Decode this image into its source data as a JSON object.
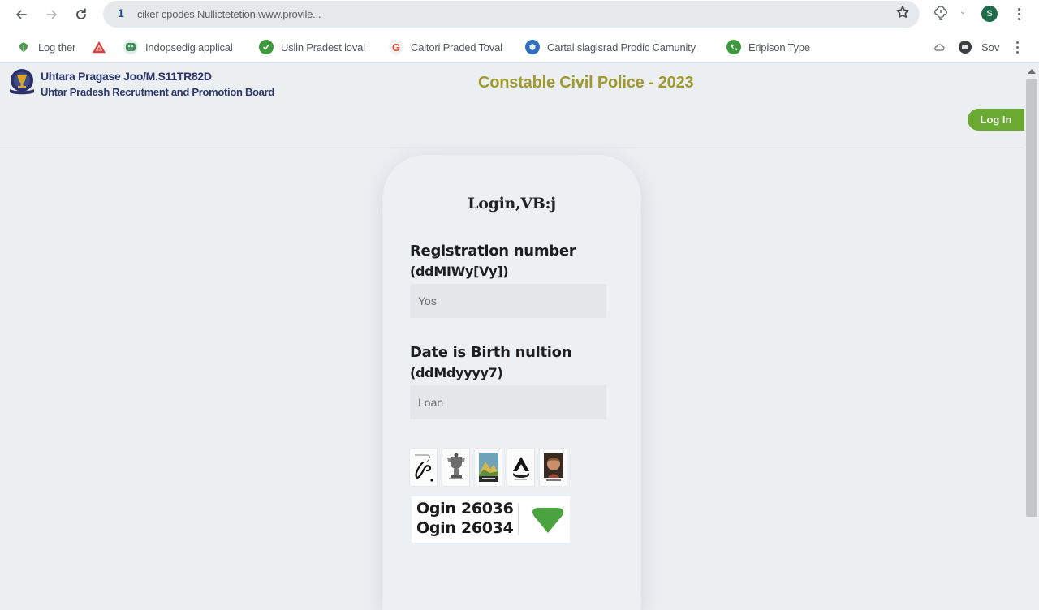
{
  "browser": {
    "url": "ciker cpodes Nullictetetion.www.provile...",
    "info_icon": "1",
    "avatar_letter": "S",
    "icons": {
      "back": "arrow-left-icon",
      "forward": "arrow-right-icon",
      "reload": "reload-icon",
      "star": "star-icon",
      "extension": "extension-icon",
      "menu": "kebab-menu-icon"
    }
  },
  "bookmarks": {
    "items": [
      {
        "label": "Log ther",
        "icon": "green-leaf-icon",
        "color": "#4d9b4a"
      },
      {
        "label": "",
        "icon": "warning-triangle-icon",
        "color": "#d9403a"
      },
      {
        "label": "Indopsedig applical",
        "icon": "green-app-icon",
        "color": "#3f8a5a"
      },
      {
        "label": "Uslin Pradest loval",
        "icon": "green-check-icon",
        "color": "#3c9a3c"
      },
      {
        "label": "Caitori Praded Toval",
        "icon": "google-icon",
        "color": "#ea4335"
      },
      {
        "label": "Cartal slagisrad Prodic Camunity",
        "icon": "blue-shield-icon",
        "color": "#2f6fc2"
      },
      {
        "label": "Eripison Type",
        "icon": "green-phone-icon",
        "color": "#3c9a3c"
      }
    ],
    "right_label": "Sov"
  },
  "header": {
    "org_line1": "Uhtara Pragase Joo/M.S11TR82D",
    "org_line2": "Uhtar Pradesh Recrutment and Promotion Board",
    "title": "Constable Civil Police - 2023",
    "login_button": "Log In",
    "title_color": "#a09a2e",
    "accent_color": "#6aaa32"
  },
  "login_card": {
    "title": "Login,VB:j",
    "registration": {
      "label": "Registration number",
      "format": "(ddMIWy[Vy])",
      "value": "Yos"
    },
    "dob": {
      "label": "Date is Birth nultion",
      "format": "(ddMdyyyy7)",
      "value": "Loan"
    },
    "captcha_images": [
      {
        "icon": "hand-drawn-symbol-icon"
      },
      {
        "icon": "trophy-statue-icon"
      },
      {
        "icon": "landscape-card-icon"
      },
      {
        "icon": "mountain-logo-icon"
      },
      {
        "icon": "portrait-icon"
      }
    ],
    "captcha_codes": [
      "Ogin 26036",
      "Ogin 26034"
    ],
    "captcha_confirm_icon": "green-heart-icon"
  }
}
